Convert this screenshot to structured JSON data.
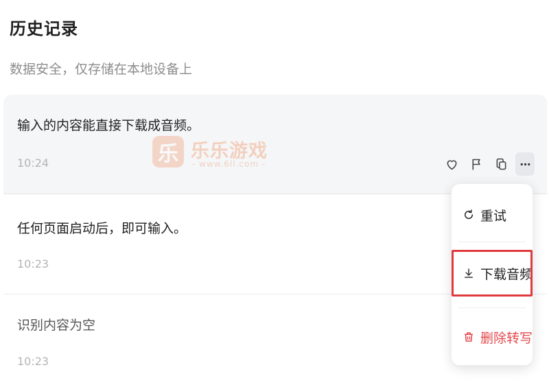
{
  "header": {
    "title": "历史记录",
    "subtitle": "数据安全，仅存储在本地设备上"
  },
  "history": [
    {
      "text": "输入的内容能直接下载成音频。",
      "time": "10:24"
    },
    {
      "text": "任何页面启动后，即可输入。",
      "time": "10:23"
    },
    {
      "text": "识别内容为空",
      "time": "10:23"
    }
  ],
  "actions": {
    "like_icon": "heart-icon",
    "flag_icon": "flag-icon",
    "copy_icon": "copy-icon",
    "more_icon": "more-icon"
  },
  "menu": {
    "retry": "重试",
    "download_audio": "下载音频",
    "delete_transcript": "删除转写"
  },
  "watermark": {
    "logo": "乐",
    "name": "乐乐游戏",
    "url": "- www.6ll.com -"
  },
  "colors": {
    "danger": "#e5484d",
    "highlight_border": "#e0393e",
    "active_row_bg": "#f5f6f8"
  }
}
